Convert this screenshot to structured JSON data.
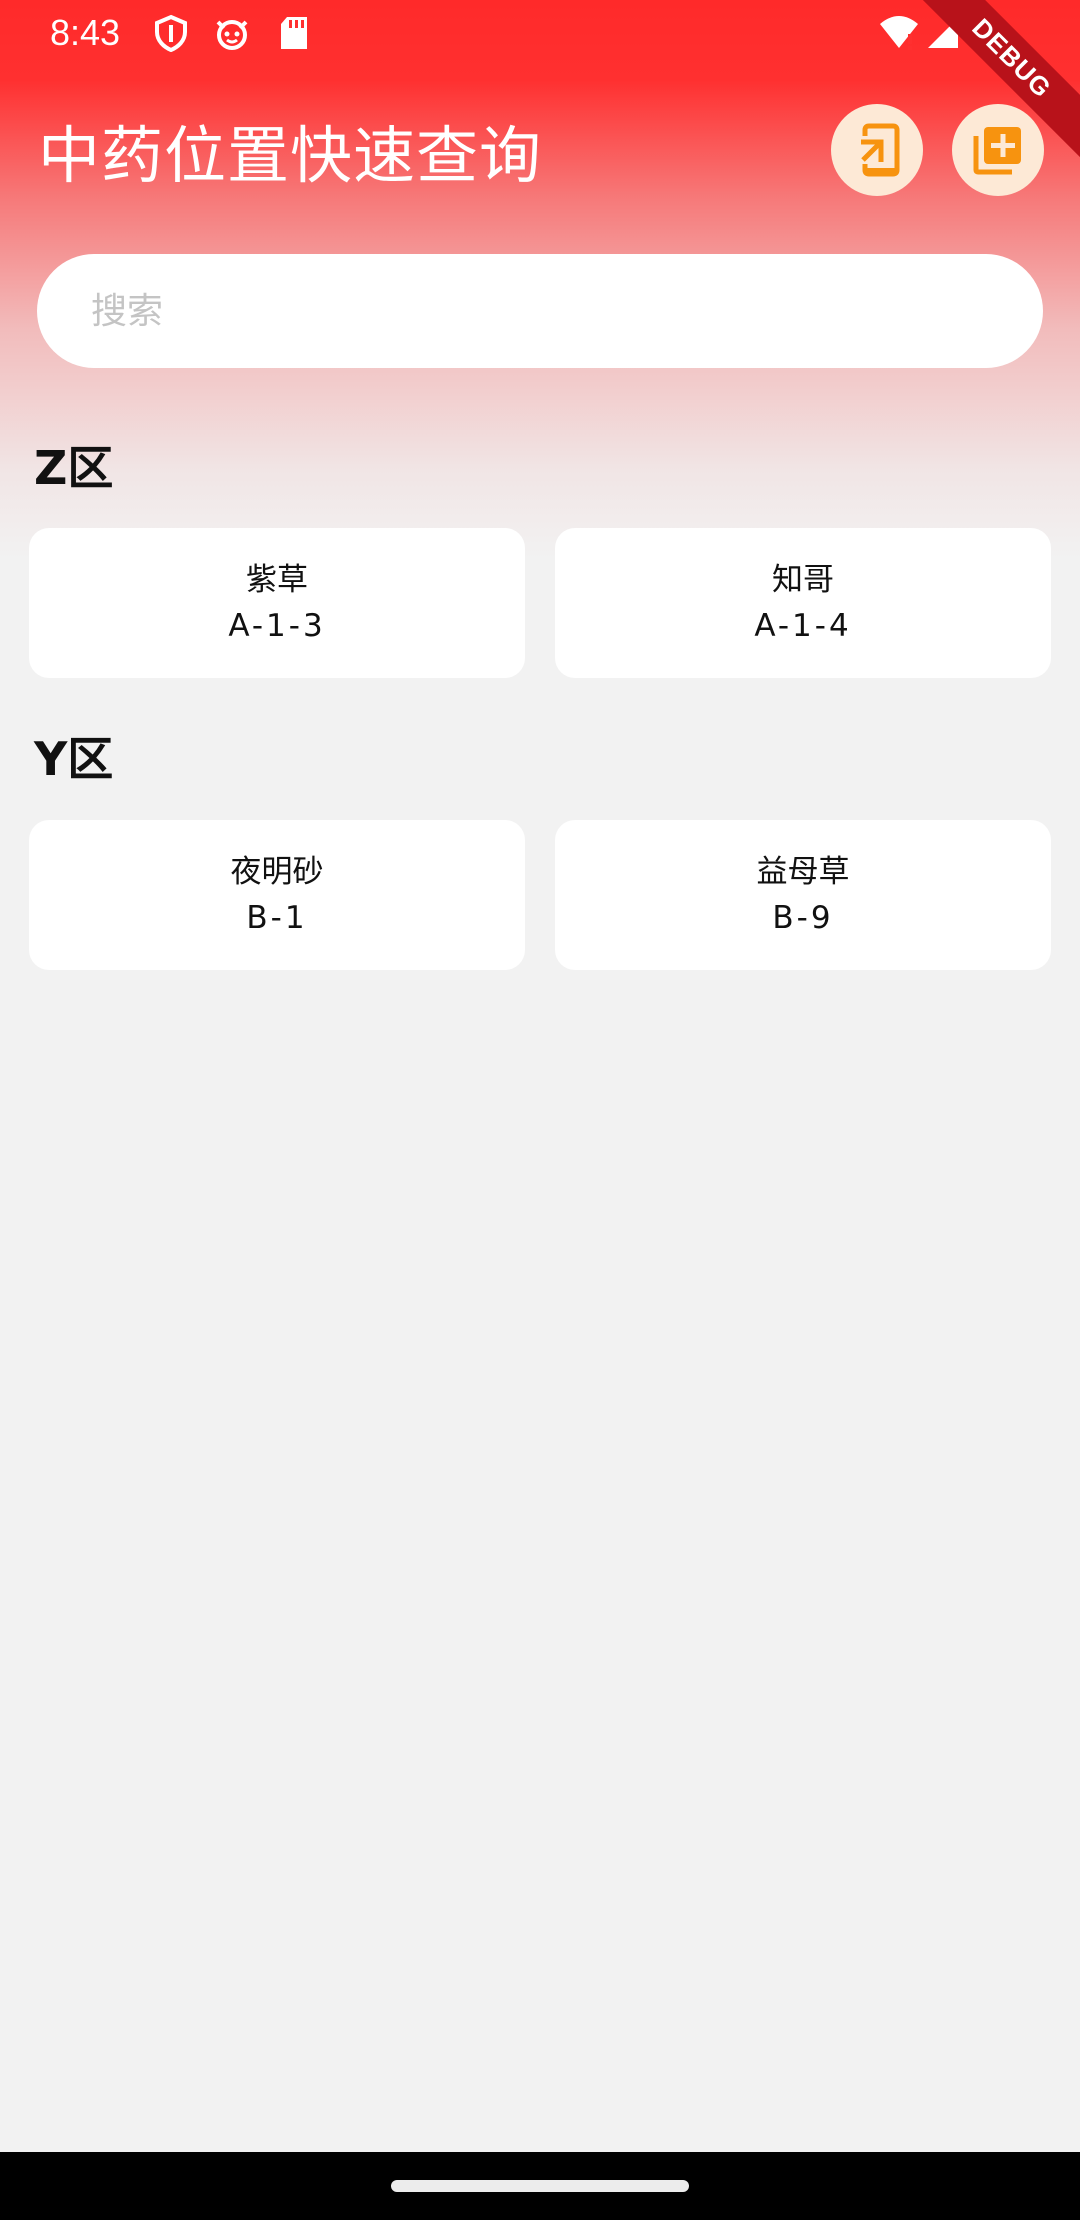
{
  "status_bar": {
    "time": "8:43",
    "icons": [
      "shield-icon",
      "cat-face-icon",
      "sd-card-icon",
      "wifi-alert-icon",
      "cell-signal-icon",
      "battery-icon"
    ]
  },
  "debug_banner": "DEBUG",
  "app_bar": {
    "title": "中药位置快速查询",
    "actions": [
      {
        "icon": "import-icon",
        "color": "#f7930f"
      },
      {
        "icon": "add-box-icon",
        "color": "#f7930f"
      }
    ]
  },
  "search": {
    "placeholder": "搜索",
    "value": ""
  },
  "sections": [
    {
      "title": "Z区",
      "items": [
        {
          "name": "紫草",
          "location": "A-1-3"
        },
        {
          "name": "知哥",
          "location": "A-1-4"
        }
      ]
    },
    {
      "title": "Y区",
      "items": [
        {
          "name": "夜明砂",
          "location": "B-1"
        },
        {
          "name": "益母草",
          "location": "B-9"
        }
      ]
    }
  ],
  "colors": {
    "header_red": "#ff2a2a",
    "accent_orange": "#f7930f",
    "button_bg": "#fde9d6",
    "background": "#f2f2f2"
  }
}
